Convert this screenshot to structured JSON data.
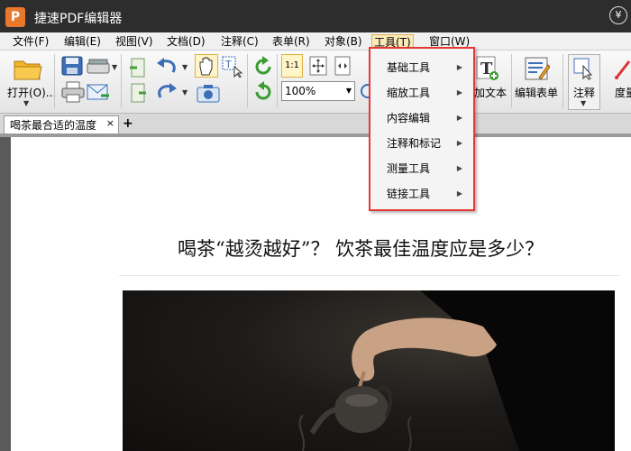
{
  "window": {
    "title": "捷速PDF编辑器",
    "logo_letter": "P",
    "yen_label": "¥"
  },
  "menubar": {
    "items": [
      "文件(F)",
      "编辑(E)",
      "视图(V)",
      "文档(D)",
      "注释(C)",
      "表单(R)",
      "对象(B)",
      "工具(T)",
      "窗口(W)"
    ],
    "active": "工具(T)"
  },
  "toolbar": {
    "open_label": "打开(O)...",
    "zoom_value": "100%",
    "ratio_label": "1:1",
    "add_text_label": "加文本",
    "edit_form_label": "编辑表单",
    "annotate_label": "注释",
    "measure_label": "度量"
  },
  "tabs": {
    "doc_tab": "喝茶最合适的温度",
    "close": "×",
    "new": "+"
  },
  "tools_menu": {
    "items": [
      "基础工具",
      "缩放工具",
      "内容编辑",
      "注释和标记",
      "测量工具",
      "链接工具"
    ]
  },
  "document": {
    "title": "喝茶“越烫越好”？ 饮茶最佳温度应是多少？"
  },
  "colors": {
    "highlight_border": "#e53935",
    "titlebar": "#2d2d2d",
    "logo": "#e8782a"
  }
}
